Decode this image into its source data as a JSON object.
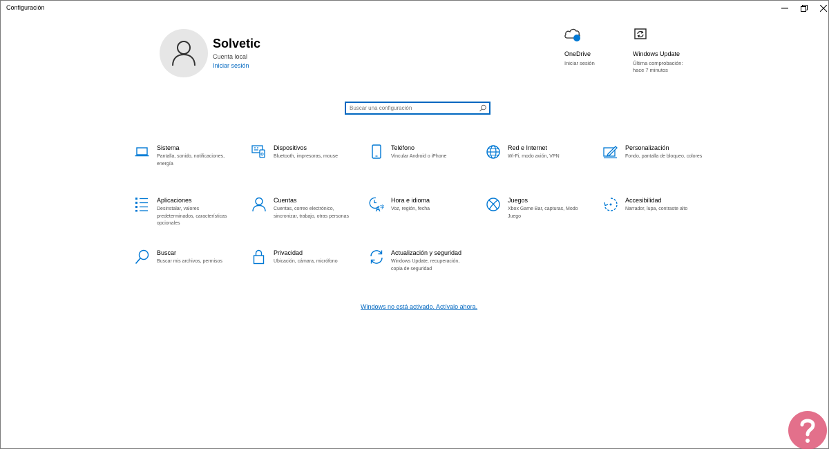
{
  "window": {
    "title": "Configuración"
  },
  "user": {
    "name": "Solvetic",
    "account_type": "Cuenta local",
    "sign_in_link": "Iniciar sesión"
  },
  "quick_status": [
    {
      "title": "OneDrive",
      "subtitle": "Iniciar sesión",
      "icon": "cloud-icon"
    },
    {
      "title": "Windows Update",
      "subtitle": "Última comprobación: hace 7 minutos",
      "icon": "update-icon"
    }
  ],
  "search": {
    "placeholder": "Buscar una configuración"
  },
  "categories": [
    {
      "title": "Sistema",
      "description": "Pantalla, sonido, notificaciones, energía",
      "icon": "laptop-icon"
    },
    {
      "title": "Dispositivos",
      "description": "Bluetooth, impresoras, mouse",
      "icon": "devices-icon"
    },
    {
      "title": "Teléfono",
      "description": "Vincular Android o iPhone",
      "icon": "phone-icon"
    },
    {
      "title": "Red e Internet",
      "description": "Wi-Fi, modo avión, VPN",
      "icon": "globe-icon"
    },
    {
      "title": "Personalización",
      "description": "Fondo, pantalla de bloqueo, colores",
      "icon": "paint-icon"
    },
    {
      "title": "Aplicaciones",
      "description": "Desinstalar, valores predeterminados, características opcionales",
      "icon": "apps-list-icon"
    },
    {
      "title": "Cuentas",
      "description": "Cuentas, correo electrónico, sincronizar, trabajo, otras personas",
      "icon": "person-icon"
    },
    {
      "title": "Hora e idioma",
      "description": "Voz, región, fecha",
      "icon": "time-language-icon"
    },
    {
      "title": "Juegos",
      "description": "Xbox Game Bar, capturas, Modo Juego",
      "icon": "xbox-icon"
    },
    {
      "title": "Accesibilidad",
      "description": "Narrador, lupa, contraste alto",
      "icon": "accessibility-icon"
    },
    {
      "title": "Buscar",
      "description": "Buscar mis archivos, permisos",
      "icon": "search-icon"
    },
    {
      "title": "Privacidad",
      "description": "Ubicación, cámara, micrófono",
      "icon": "lock-icon"
    },
    {
      "title": "Actualización y seguridad",
      "description": "Windows Update, recuperación, copia de seguridad",
      "icon": "sync-icon"
    }
  ],
  "activation": {
    "text": "Windows no está activado. Actívalo ahora."
  },
  "colors": {
    "accent": "#0067c0",
    "icon_blue": "#0078d4",
    "avatar_bg": "#e6e6e6",
    "watermark_pink": "#e0607e"
  }
}
